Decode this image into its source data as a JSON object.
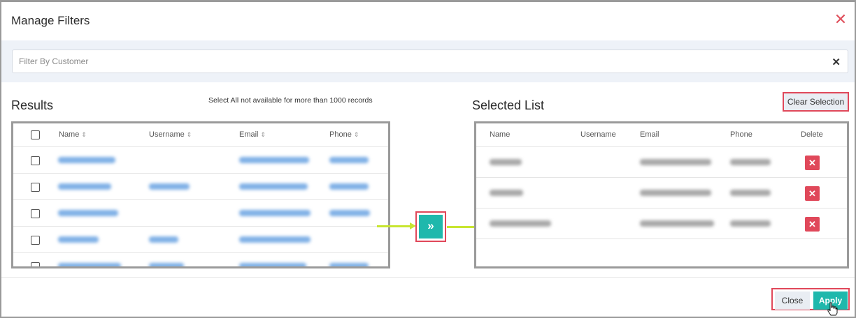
{
  "modal": {
    "title": "Manage Filters",
    "close_icon": "close-icon"
  },
  "filter": {
    "placeholder": "Filter By Customer",
    "clear_icon": "clear-icon"
  },
  "results": {
    "title": "Results",
    "note": "Select All not available for more than 1000 records",
    "columns": [
      "Name",
      "Username",
      "Email",
      "Phone"
    ],
    "sort_icon": "sort-icon"
  },
  "selected": {
    "title": "Selected List",
    "clear_label": "Clear Selection",
    "columns": [
      "Name",
      "Username",
      "Email",
      "Phone",
      "Delete"
    ],
    "delete_icon": "delete-icon"
  },
  "transfer": {
    "icon": "double-chevron-right-icon",
    "glyph": "»"
  },
  "footer": {
    "close_label": "Close",
    "apply_label": "Apply"
  },
  "colors": {
    "accent": "#1fb8ac",
    "danger": "#e0485a",
    "link": "#7fb0e6",
    "highlight_arrow": "#c8e630"
  }
}
